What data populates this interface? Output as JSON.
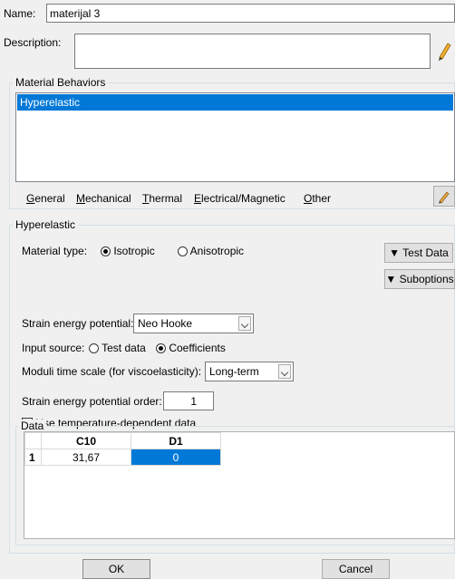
{
  "header": {
    "name_label": "Name:",
    "name_value": "materijal 3",
    "description_label": "Description:",
    "description_value": ""
  },
  "material_behaviors": {
    "title": "Material Behaviors",
    "items": [
      {
        "label": "Hyperelastic",
        "selected": true
      }
    ]
  },
  "menu": [
    {
      "ul": "G",
      "rest": "eneral"
    },
    {
      "ul": "M",
      "rest": "echanical"
    },
    {
      "ul": "T",
      "rest": "hermal"
    },
    {
      "ul": "E",
      "rest": "lectrical/Magnetic"
    },
    {
      "ul": "O",
      "rest": "ther"
    }
  ],
  "hyperelastic": {
    "title": "Hyperelastic",
    "material_type_label": "Material type:",
    "material_type_options": [
      "Isotropic",
      "Anisotropic"
    ],
    "material_type_selected": "Isotropic",
    "test_data_button": "Test Data",
    "suboptions_button": "Suboptions",
    "strain_energy_label": "Strain energy potential:",
    "strain_energy_value": "Neo Hooke",
    "input_source_label": "Input source:",
    "input_source_options": [
      "Test data",
      "Coefficients"
    ],
    "input_source_selected": "Coefficients",
    "moduli_label": "Moduli time scale (for viscoelasticity):",
    "moduli_value": "Long-term",
    "order_label": "Strain energy potential order:",
    "order_value": "1",
    "temp_dependent_label": "Use temperature-dependent data",
    "temp_dependent_checked": false
  },
  "data_table": {
    "title": "Data",
    "columns": [
      "C10",
      "D1"
    ],
    "rows": [
      {
        "index": "1",
        "cells": [
          "31,67",
          "0"
        ]
      }
    ]
  },
  "footer": {
    "ok_label": "OK",
    "cancel_label": "Cancel"
  },
  "colors": {
    "selection": "#0078d7",
    "background": "#f0f0f0"
  }
}
